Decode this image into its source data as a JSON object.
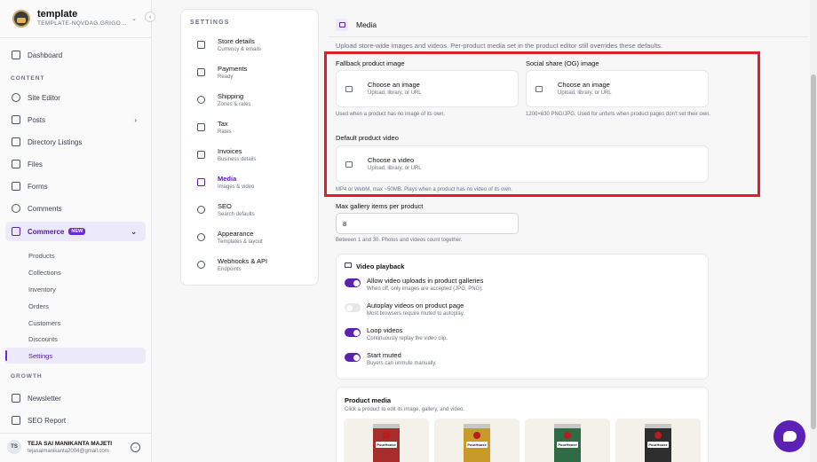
{
  "brand": {
    "name": "template",
    "subtitle": "TEMPLATE-NQVDAG.GRIGOR..."
  },
  "nav": {
    "dashboard": "Dashboard",
    "section_content": "CONTENT",
    "site_editor": "Site Editor",
    "posts": "Posts",
    "directory": "Directory Listings",
    "files": "Files",
    "forms": "Forms",
    "comments": "Comments",
    "commerce": "Commerce",
    "commerce_badge": "NEW",
    "commerce_sub": [
      "Products",
      "Collections",
      "Inventory",
      "Orders",
      "Customers",
      "Discounts",
      "Settings"
    ],
    "section_growth": "GROWTH",
    "newsletter": "Newsletter",
    "seo_report": "SEO Report"
  },
  "user": {
    "initials": "TS",
    "name": "TEJA SAI MANIKANTA MAJETI",
    "email": "tejasaimanikanta2004@gmail.com"
  },
  "settings": {
    "title": "SETTINGS",
    "items": [
      {
        "title": "Store details",
        "sub": "Currency & emails"
      },
      {
        "title": "Payments",
        "sub": "Ready"
      },
      {
        "title": "Shipping",
        "sub": "Zones & rates"
      },
      {
        "title": "Tax",
        "sub": "Rates"
      },
      {
        "title": "Invoices",
        "sub": "Business details"
      },
      {
        "title": "Media",
        "sub": "Images & video"
      },
      {
        "title": "SEO",
        "sub": "Search defaults"
      },
      {
        "title": "Appearance",
        "sub": "Templates & layout"
      },
      {
        "title": "Webhooks & API",
        "sub": "Endpoints"
      }
    ]
  },
  "media": {
    "title": "Media",
    "description": "Upload store-wide images and videos. Per-product media set in the product editor still overrides these defaults.",
    "fallback": {
      "label": "Fallback product image",
      "button": "Choose an image",
      "button_sub": "Upload, library, or URL",
      "hint": "Used when a product has no image of its own."
    },
    "og": {
      "label": "Social share (OG) image",
      "button": "Choose an image",
      "button_sub": "Upload, library, or URL",
      "hint": "1200×630 PNG/JPG. Used for unfurls when product pages don't set their own."
    },
    "video": {
      "label": "Default product video",
      "button": "Choose a video",
      "button_sub": "Upload, library, or URL",
      "hint": "MP4 or WebM, max ~50MB. Plays when a product has no video of its own."
    },
    "gallery": {
      "label": "Max gallery items per product",
      "value": "8",
      "hint": "Between 1 and 30. Photos and videos count together."
    },
    "playback": {
      "title": "Video playback",
      "toggles": [
        {
          "title": "Allow video uploads in product galleries",
          "sub": "When off, only images are accepted (JPG, PNG).",
          "on": true
        },
        {
          "title": "Autoplay videos on product page",
          "sub": "Most browsers require muted to autoplay.",
          "on": false
        },
        {
          "title": "Loop videos",
          "sub": "Continuously replay the video clip.",
          "on": true
        },
        {
          "title": "Start muted",
          "sub": "Buyers can unmute manually.",
          "on": true
        }
      ]
    },
    "product_media": {
      "title": "Product media",
      "sub": "Click a product to edit its image, gallery, and video.",
      "products": [
        {
          "brand": "PourHouse",
          "color": "#a82d2d"
        },
        {
          "brand": "PourHouse",
          "color": "#c89a2a"
        },
        {
          "brand": "PourHouse",
          "color": "#2f6b45"
        },
        {
          "brand": "PourHouse",
          "color": "#2e2e2e"
        }
      ]
    }
  },
  "colors": {
    "accent": "#5b21b6",
    "highlight": "#e11d2a"
  }
}
